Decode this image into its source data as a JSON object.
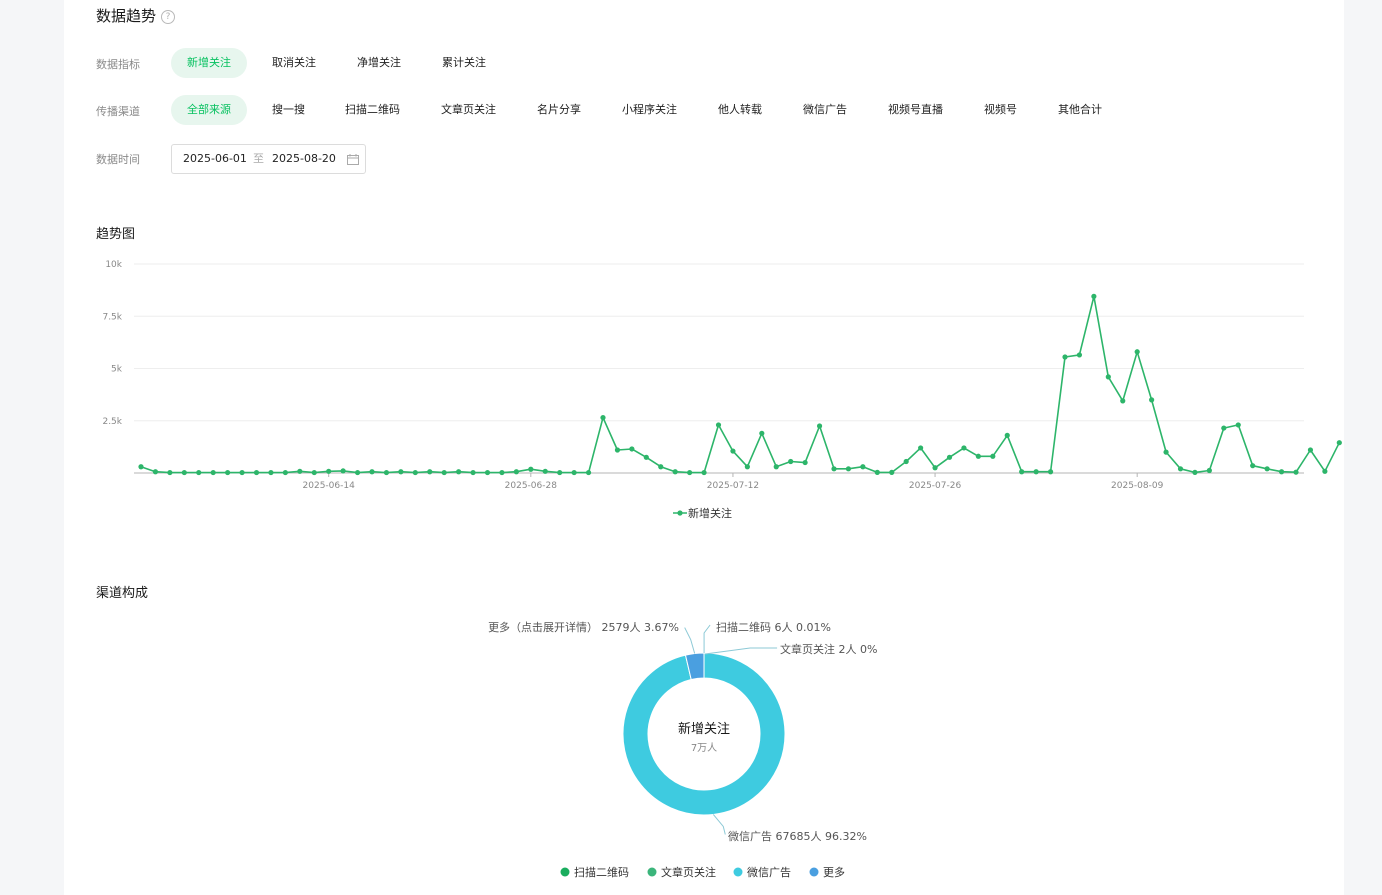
{
  "trend": {
    "title": "数据趋势",
    "help_icon": "?",
    "metric_label": "数据指标",
    "metrics": [
      "新增关注",
      "取消关注",
      "净增关注",
      "累计关注"
    ],
    "channel_label": "传播渠道",
    "channels": [
      "全部来源",
      "搜一搜",
      "扫描二维码",
      "文章页关注",
      "名片分享",
      "小程序关注",
      "他人转载",
      "微信广告",
      "视频号直播",
      "视频号",
      "其他合计"
    ],
    "time_label": "数据时间",
    "date_start": "2025-06-01",
    "date_sep": "至",
    "date_end": "2025-08-20"
  },
  "trend_chart_title": "趋势图",
  "composition_title": "渠道构成",
  "colors": {
    "accent": "#07c160",
    "line": "#2db56a",
    "donut_main": "#3ecbe0",
    "donut_more": "#4a9fe0",
    "legend_scan": "#1aad5e",
    "legend_article": "#3bb57b"
  },
  "chart_data": [
    {
      "type": "line",
      "x": [
        "2025-06-01",
        "2025-06-02",
        "2025-06-03",
        "2025-06-04",
        "2025-06-05",
        "2025-06-06",
        "2025-06-07",
        "2025-06-08",
        "2025-06-09",
        "2025-06-10",
        "2025-06-11",
        "2025-06-12",
        "2025-06-13",
        "2025-06-14",
        "2025-06-15",
        "2025-06-16",
        "2025-06-17",
        "2025-06-18",
        "2025-06-19",
        "2025-06-20",
        "2025-06-21",
        "2025-06-22",
        "2025-06-23",
        "2025-06-24",
        "2025-06-25",
        "2025-06-26",
        "2025-06-27",
        "2025-06-28",
        "2025-06-29",
        "2025-06-30",
        "2025-07-01",
        "2025-07-02",
        "2025-07-03",
        "2025-07-04",
        "2025-07-05",
        "2025-07-06",
        "2025-07-07",
        "2025-07-08",
        "2025-07-09",
        "2025-07-10",
        "2025-07-11",
        "2025-07-12",
        "2025-07-13",
        "2025-07-14",
        "2025-07-15",
        "2025-07-16",
        "2025-07-17",
        "2025-07-18",
        "2025-07-19",
        "2025-07-20",
        "2025-07-21",
        "2025-07-22",
        "2025-07-23",
        "2025-07-24",
        "2025-07-25",
        "2025-07-26",
        "2025-07-27",
        "2025-07-28",
        "2025-07-29",
        "2025-07-30",
        "2025-07-31",
        "2025-08-01",
        "2025-08-02",
        "2025-08-03",
        "2025-08-04",
        "2025-08-05",
        "2025-08-06",
        "2025-08-07",
        "2025-08-08",
        "2025-08-09",
        "2025-08-10",
        "2025-08-11",
        "2025-08-12",
        "2025-08-13",
        "2025-08-14",
        "2025-08-15",
        "2025-08-16",
        "2025-08-17",
        "2025-08-18",
        "2025-08-19",
        "2025-08-20"
      ],
      "tick_labels": [
        "2025-06-14",
        "2025-06-28",
        "2025-07-12",
        "2025-07-26",
        "2025-08-09"
      ],
      "series": [
        {
          "name": "新增关注",
          "values": [
            300,
            60,
            20,
            20,
            20,
            20,
            20,
            20,
            20,
            20,
            20,
            80,
            20,
            80,
            100,
            20,
            60,
            20,
            60,
            20,
            60,
            20,
            60,
            20,
            20,
            20,
            60,
            180,
            80,
            20,
            20,
            20,
            2650,
            1100,
            1150,
            750,
            300,
            60,
            20,
            20,
            2300,
            1050,
            300,
            1900,
            300,
            550,
            500,
            2250,
            200,
            200,
            300,
            30,
            30,
            550,
            1200,
            250,
            750,
            1200,
            800,
            800,
            1800,
            60,
            60,
            60,
            5550,
            5650,
            8450,
            4600,
            3450,
            5800,
            3500,
            1000,
            200,
            30,
            120,
            2150,
            2300,
            350,
            200,
            60,
            40,
            1100,
            80,
            1450
          ]
        }
      ],
      "ylim": [
        0,
        10000
      ],
      "yticks": [
        "2.5k",
        "5k",
        "7.5k",
        "10k"
      ],
      "legend": "bottom-center"
    },
    {
      "type": "pie",
      "center_title": "新增关注",
      "center_value": "7万人",
      "slices": [
        {
          "name": "扫描二维码",
          "value": 6,
          "percent": 0.01,
          "label": "扫描二维码 6人 0.01%"
        },
        {
          "name": "文章页关注",
          "value": 2,
          "percent": 0,
          "label": "文章页关注 2人 0%"
        },
        {
          "name": "微信广告",
          "value": 67685,
          "percent": 96.32,
          "label": "微信广告 67685人 96.32%"
        },
        {
          "name": "更多",
          "value": 2579,
          "percent": 3.67,
          "label": "更多（点击展开详情） 2579人 3.67%"
        }
      ],
      "legend": "bottom-center"
    }
  ]
}
